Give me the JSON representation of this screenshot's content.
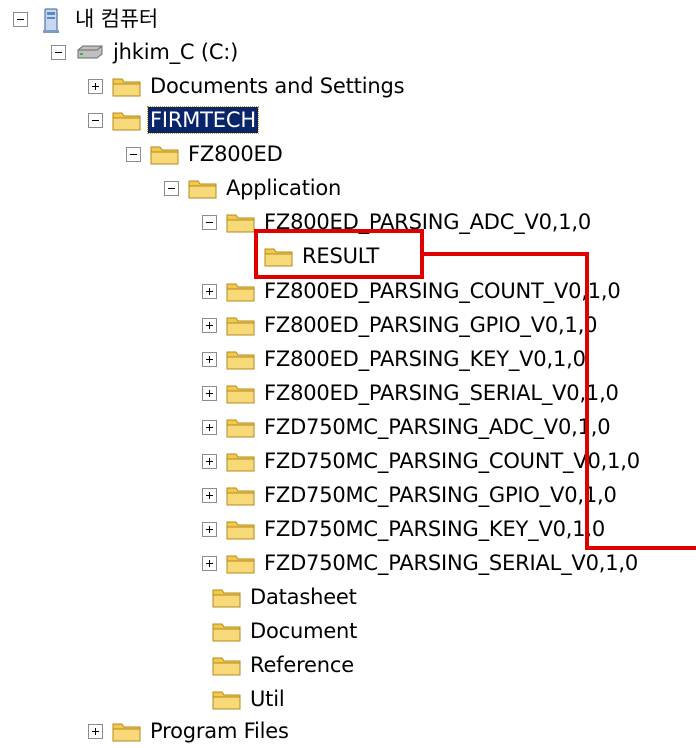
{
  "tree": {
    "my_computer": "내 컴퓨터",
    "drive": "jhkim_C (C:)",
    "documents_and_settings": "Documents and Settings",
    "firmtech": "FIRMTECH",
    "fz800ed": "FZ800ED",
    "application": "Application",
    "app_children": [
      "FZ800ED_PARSING_ADC_V0,1,0",
      "FZ800ED_PARSING_COUNT_V0,1,0",
      "FZ800ED_PARSING_GPIO_V0,1,0",
      "FZ800ED_PARSING_KEY_V0,1,0",
      "FZ800ED_PARSING_SERIAL_V0,1,0",
      "FZD750MC_PARSING_ADC_V0,1,0",
      "FZD750MC_PARSING_COUNT_V0,1,0",
      "FZD750MC_PARSING_GPIO_V0,1,0",
      "FZD750MC_PARSING_KEY_V0,1,0",
      "FZD750MC_PARSING_SERIAL_V0,1,0"
    ],
    "result": "RESULT",
    "datasheet": "Datasheet",
    "document": "Document",
    "reference": "Reference",
    "util": "Util",
    "program_files": "Program Files"
  },
  "colors": {
    "selection_bg": "#0a246a",
    "highlight": "#e00000",
    "folder": "#f2c94c"
  },
  "icons": {
    "computer": "my-computer-icon",
    "drive": "hard-drive-icon",
    "folder": "folder-icon"
  }
}
